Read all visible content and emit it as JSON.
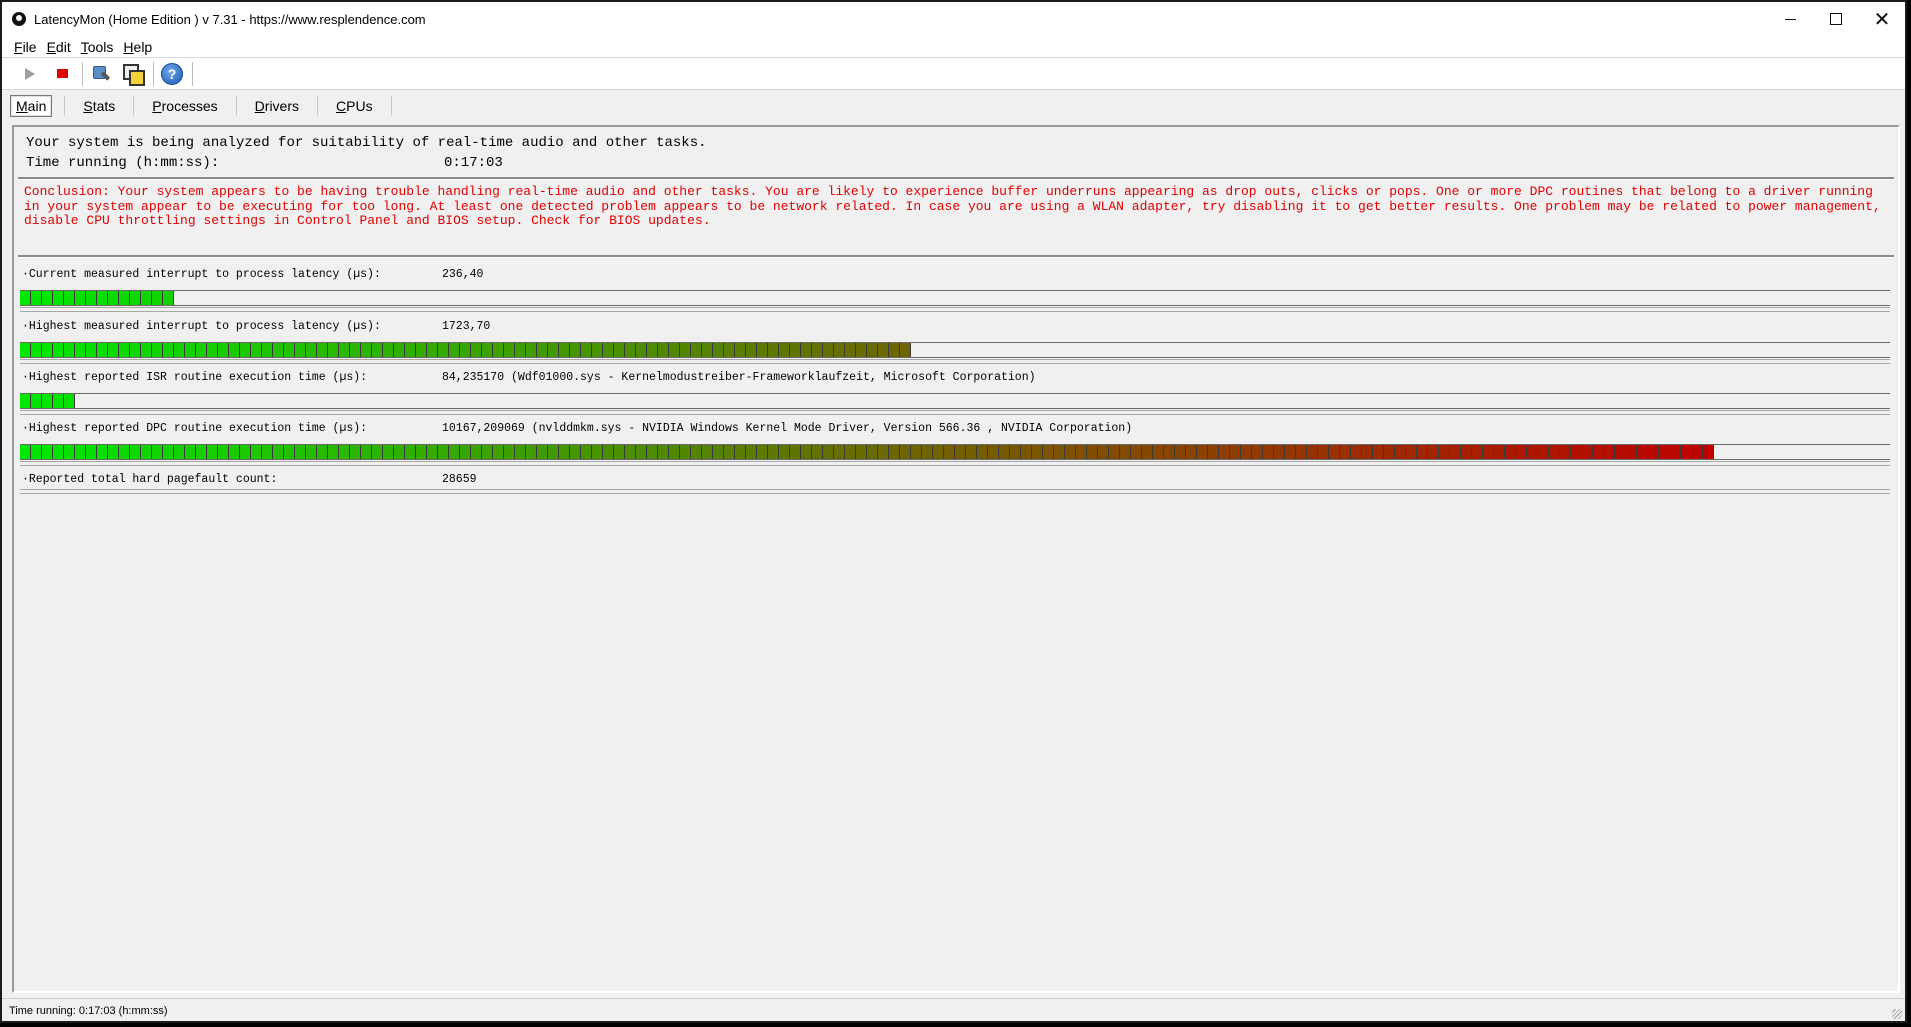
{
  "window": {
    "title": "LatencyMon  (Home Edition )  v 7.31 - https://www.resplendence.com"
  },
  "menu": {
    "items": [
      {
        "key": "F",
        "rest": "ile"
      },
      {
        "key": "E",
        "rest": "dit"
      },
      {
        "key": "T",
        "rest": "ools"
      },
      {
        "key": "H",
        "rest": "elp"
      }
    ]
  },
  "toolbar": {
    "icons": [
      "play-icon",
      "stop-icon",
      "tools-icon",
      "copy-icon",
      "help-icon"
    ],
    "help_glyph": "?"
  },
  "tabs": [
    {
      "key": "M",
      "rest": "ain",
      "active": true
    },
    {
      "key": "S",
      "rest": "tats",
      "active": false
    },
    {
      "key": "P",
      "rest": "rocesses",
      "active": false
    },
    {
      "key": "D",
      "rest": "rivers",
      "active": false
    },
    {
      "key": "C",
      "rest": "PUs",
      "active": false
    }
  ],
  "analysis": {
    "status": "Your system is being analyzed for suitability of real-time audio and other tasks.",
    "time_label": "Time running (h:mm:ss):",
    "time_value": "0:17:03"
  },
  "conclusion": "Conclusion: Your system appears to be having trouble handling real-time audio and other tasks. You are likely to experience buffer underruns appearing as drop outs, clicks or pops. One or more DPC routines that belong to a driver running in your system appear to be executing for too long. At least one detected problem appears to be network related. In case you are using a WLAN adapter, try disabling it to get better results. One problem may be related to power management, disable CPU throttling settings in Control Panel and BIOS setup. Check for BIOS updates.",
  "metrics": [
    {
      "label": "·Current measured interrupt to process latency (µs):",
      "value": "236,40",
      "segments": 14,
      "bar": true
    },
    {
      "label": "·Highest measured interrupt to process latency (µs):",
      "value": "1723,70",
      "segments": 81,
      "bar": true
    },
    {
      "label": "·Highest reported ISR routine execution time (µs):",
      "value": "84,235170  (Wdf01000.sys - Kernelmodustreiber-Frameworklaufzeit, Microsoft Corporation)",
      "segments": 5,
      "bar": true
    },
    {
      "label": "·Highest reported DPC routine execution time (µs):",
      "value": "10167,209069  (nvlddmkm.sys - NVIDIA Windows Kernel Mode Driver, Version 566.36 , NVIDIA Corporation)",
      "segments": 154,
      "bar": true
    },
    {
      "label": "·Reported total hard pagefault count:",
      "value": "28659",
      "segments": 0,
      "bar": false
    }
  ],
  "bar_colors": {
    "start": "#00e800",
    "mid": "#6a6a00",
    "end": "#c00000"
  },
  "statusbar": {
    "text": "Time running: 0:17:03  (h:mm:ss)"
  }
}
